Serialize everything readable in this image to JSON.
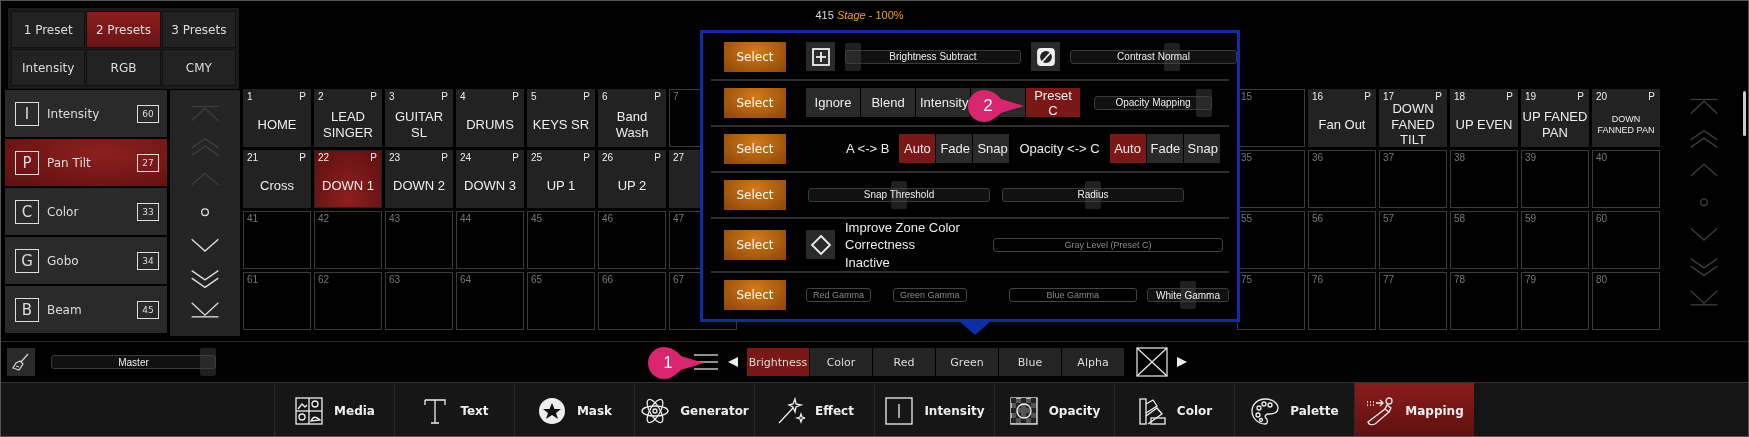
{
  "title": {
    "number": "415",
    "stage": "Stage",
    "level": "- 100%"
  },
  "preset_modes": [
    {
      "label": "1 Preset",
      "selected": false
    },
    {
      "label": "2 Presets",
      "selected": true
    },
    {
      "label": "3 Presets",
      "selected": false
    },
    {
      "label": "Intensity",
      "selected": false
    },
    {
      "label": "RGB",
      "selected": false
    },
    {
      "label": "CMY",
      "selected": false
    }
  ],
  "attributes": [
    {
      "letter": "I",
      "label": "Intensity",
      "count": "60",
      "selected": false
    },
    {
      "letter": "P",
      "label": "Pan Tilt",
      "count": "27",
      "selected": true
    },
    {
      "letter": "C",
      "label": "Color",
      "count": "33",
      "selected": false
    },
    {
      "letter": "G",
      "label": "Gobo",
      "count": "34",
      "selected": false
    },
    {
      "letter": "B",
      "label": "Beam",
      "count": "45",
      "selected": false
    }
  ],
  "left_scroller": [
    {
      "kind": "top",
      "disabled": true
    },
    {
      "kind": "page-up",
      "disabled": true
    },
    {
      "kind": "up",
      "disabled": true
    },
    {
      "kind": "dot",
      "disabled": false
    },
    {
      "kind": "down",
      "disabled": false
    },
    {
      "kind": "page-down",
      "disabled": false
    },
    {
      "kind": "bottom",
      "disabled": false
    }
  ],
  "grid_rows": [
    {
      "left": [
        {
          "number": "1",
          "tag": "P",
          "label": "HOME",
          "selected": false
        },
        {
          "number": "2",
          "tag": "P",
          "label": "LEAD SINGER",
          "selected": false
        },
        {
          "number": "3",
          "tag": "P",
          "label": "GUITAR SL",
          "selected": false
        },
        {
          "number": "4",
          "tag": "P",
          "label": "DRUMS",
          "selected": false
        },
        {
          "number": "5",
          "tag": "P",
          "label": "KEYS SR",
          "selected": false
        },
        {
          "number": "6",
          "tag": "P",
          "label": "Band Wash",
          "selected": false
        },
        {
          "number": "7"
        }
      ],
      "right": [
        {
          "number": "15"
        },
        {
          "number": "16",
          "tag": "P",
          "label": "Fan Out",
          "selected": false
        },
        {
          "number": "17",
          "tag": "P",
          "label": "DOWN FANED TILT",
          "selected": false
        },
        {
          "number": "18",
          "tag": "P",
          "label": "UP EVEN",
          "selected": false
        },
        {
          "number": "19",
          "tag": "P",
          "label": "UP FANED PAN",
          "selected": false
        },
        {
          "number": "20",
          "tag": "P",
          "label": "DOWN FANNED PAN",
          "selected": false,
          "small": true
        }
      ]
    },
    {
      "left": [
        {
          "number": "21",
          "tag": "P",
          "label": "Cross",
          "selected": false
        },
        {
          "number": "22",
          "tag": "P",
          "label": "DOWN 1",
          "selected": true
        },
        {
          "number": "23",
          "tag": "P",
          "label": "DOWN 2",
          "selected": false
        },
        {
          "number": "24",
          "tag": "P",
          "label": "DOWN 3",
          "selected": false
        },
        {
          "number": "25",
          "tag": "P",
          "label": "UP 1",
          "selected": false
        },
        {
          "number": "26",
          "tag": "P",
          "label": "UP 2",
          "selected": false
        },
        {
          "number": "27",
          "selected": false
        }
      ],
      "right": [
        {
          "number": "35"
        },
        {
          "number": "36"
        },
        {
          "number": "37"
        },
        {
          "number": "38"
        },
        {
          "number": "39"
        },
        {
          "number": "40"
        }
      ]
    },
    {
      "left": [
        {
          "number": "41"
        },
        {
          "number": "42"
        },
        {
          "number": "43"
        },
        {
          "number": "44"
        },
        {
          "number": "45"
        },
        {
          "number": "46"
        },
        {
          "number": "47"
        }
      ],
      "right": [
        {
          "number": "55"
        },
        {
          "number": "56"
        },
        {
          "number": "57"
        },
        {
          "number": "58"
        },
        {
          "number": "59"
        },
        {
          "number": "60"
        }
      ]
    },
    {
      "left": [
        {
          "number": "61"
        },
        {
          "number": "62"
        },
        {
          "number": "63"
        },
        {
          "number": "64"
        },
        {
          "number": "65"
        },
        {
          "number": "66"
        },
        {
          "number": "67"
        }
      ],
      "right": [
        {
          "number": "75"
        },
        {
          "number": "76"
        },
        {
          "number": "77"
        },
        {
          "number": "78"
        },
        {
          "number": "79"
        },
        {
          "number": "80"
        }
      ]
    }
  ],
  "right_scroller": [
    {
      "kind": "top",
      "disabled": true
    },
    {
      "kind": "page-up",
      "disabled": true
    },
    {
      "kind": "up",
      "disabled": true
    },
    {
      "kind": "dot",
      "disabled": true
    },
    {
      "kind": "down",
      "disabled": true
    },
    {
      "kind": "page-down",
      "disabled": true
    },
    {
      "kind": "bottom",
      "disabled": true
    }
  ],
  "popup": {
    "rows": [
      {
        "select": "Select",
        "items": [
          {
            "kind": "plus-button"
          },
          {
            "kind": "slider",
            "label": "Brightness Subtract",
            "level": 0.0
          },
          {
            "kind": "contrast-button"
          },
          {
            "kind": "slider",
            "label": "Contrast Normal",
            "level": 0.62
          }
        ]
      },
      {
        "select": "Select",
        "items": [
          {
            "kind": "segments",
            "options": [
              {
                "label": "Ignore",
                "selected": false
              },
              {
                "label": "Blend",
                "selected": false
              },
              {
                "label": "Intensity",
                "selected": false
              },
              {
                "selected": false
              },
              {
                "label": "Preset C",
                "selected": true
              }
            ]
          },
          {
            "kind": "slider",
            "label": "Opacity Mapping",
            "level": 1.0
          }
        ]
      },
      {
        "select": "Select",
        "items": [
          {
            "kind": "text",
            "text": "A <-> B"
          },
          {
            "kind": "segments",
            "options": [
              {
                "label": "Auto",
                "selected": true
              },
              {
                "label": "Fade",
                "selected": false
              },
              {
                "label": "Snap",
                "selected": false
              }
            ]
          },
          {
            "kind": "text",
            "text": "Opacity <-> C"
          },
          {
            "kind": "segments",
            "options": [
              {
                "label": "Auto",
                "selected": true
              },
              {
                "label": "Fade",
                "selected": false
              },
              {
                "label": "Snap",
                "selected": false
              }
            ]
          }
        ]
      },
      {
        "select": "Select",
        "items": [
          {
            "kind": "slider",
            "label": "Snap Threshold",
            "level": 0.5
          },
          {
            "kind": "slider",
            "label": "Radius",
            "level": 0.5
          }
        ]
      },
      {
        "select": "Select",
        "items": [
          {
            "kind": "diamond-button"
          },
          {
            "kind": "text",
            "text": "Improve Zone Color Correctness Inactive",
            "wrap": true
          },
          {
            "kind": "field",
            "label": "Gray Level (Preset C)",
            "disabled": true
          }
        ]
      },
      {
        "select": "Select",
        "items": [
          {
            "kind": "field",
            "label": "Red Gamma",
            "disabled": true
          },
          {
            "kind": "field",
            "label": "Green Gamma",
            "disabled": true
          },
          {
            "kind": "field",
            "label": "Blue Gamma",
            "disabled": true
          },
          {
            "kind": "slider",
            "label": "White Gamma",
            "level": 0.5
          }
        ]
      }
    ]
  },
  "callouts": [
    "1",
    "2"
  ],
  "master": {
    "label": "Master",
    "level": 1.0
  },
  "channel_tabs": [
    {
      "label": "Brightness",
      "selected": true
    },
    {
      "label": "Color",
      "selected": false
    },
    {
      "label": "Red",
      "selected": false
    },
    {
      "label": "Green",
      "selected": false
    },
    {
      "label": "Blue",
      "selected": false
    },
    {
      "label": "Alpha",
      "selected": false
    }
  ],
  "toolbar": [
    {
      "kind": "media",
      "label": "Media",
      "selected": false
    },
    {
      "kind": "text",
      "label": "Text",
      "selected": false
    },
    {
      "kind": "mask",
      "label": "Mask",
      "selected": false
    },
    {
      "kind": "generator",
      "label": "Generator",
      "selected": false
    },
    {
      "kind": "effect",
      "label": "Effect",
      "selected": false
    },
    {
      "kind": "intensity",
      "label": "Intensity",
      "selected": false
    },
    {
      "kind": "opacity",
      "label": "Opacity",
      "selected": false
    },
    {
      "kind": "color",
      "label": "Color",
      "selected": false
    },
    {
      "kind": "palette",
      "label": "Palette",
      "selected": false
    },
    {
      "kind": "mapping",
      "label": "Mapping",
      "selected": true
    }
  ]
}
